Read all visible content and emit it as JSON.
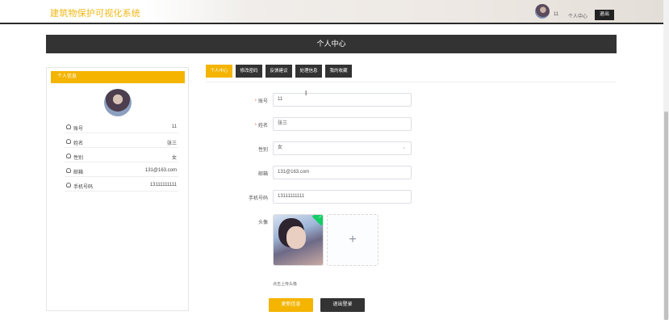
{
  "header": {
    "brand": "建筑物保护可视化系统",
    "username": "11",
    "profile_link": "个人中心",
    "logout_button": "退出"
  },
  "page_title": "个人中心",
  "sidebar": {
    "heading": "个人信息",
    "rows": [
      {
        "key": "账号",
        "value": "11"
      },
      {
        "key": "姓名",
        "value": "张三"
      },
      {
        "key": "性别",
        "value": "女"
      },
      {
        "key": "邮箱",
        "value": "131@163.com"
      },
      {
        "key": "手机号码",
        "value": "13111111111"
      }
    ]
  },
  "tabs": [
    {
      "label": "个人中心",
      "active": true
    },
    {
      "label": "修改密码",
      "active": false
    },
    {
      "label": "反馈建议",
      "active": false
    },
    {
      "label": "处理信息",
      "active": false
    },
    {
      "label": "我的收藏",
      "active": false
    }
  ],
  "form": {
    "account": {
      "label": "账号",
      "value": "11",
      "required": true
    },
    "name": {
      "label": "姓名",
      "value": "张三",
      "required": true
    },
    "gender": {
      "label": "性别",
      "value": "女"
    },
    "email": {
      "label": "邮箱",
      "value": "131@163.com"
    },
    "phone": {
      "label": "手机号码",
      "value": "13111111111"
    },
    "avatar": {
      "label": "头像",
      "tip": "点击上传头像"
    }
  },
  "buttons": {
    "update": "更新信息",
    "logout": "退出登录"
  },
  "colors": {
    "accent": "#f4b400",
    "dark": "#333333",
    "success": "#13ce66"
  }
}
